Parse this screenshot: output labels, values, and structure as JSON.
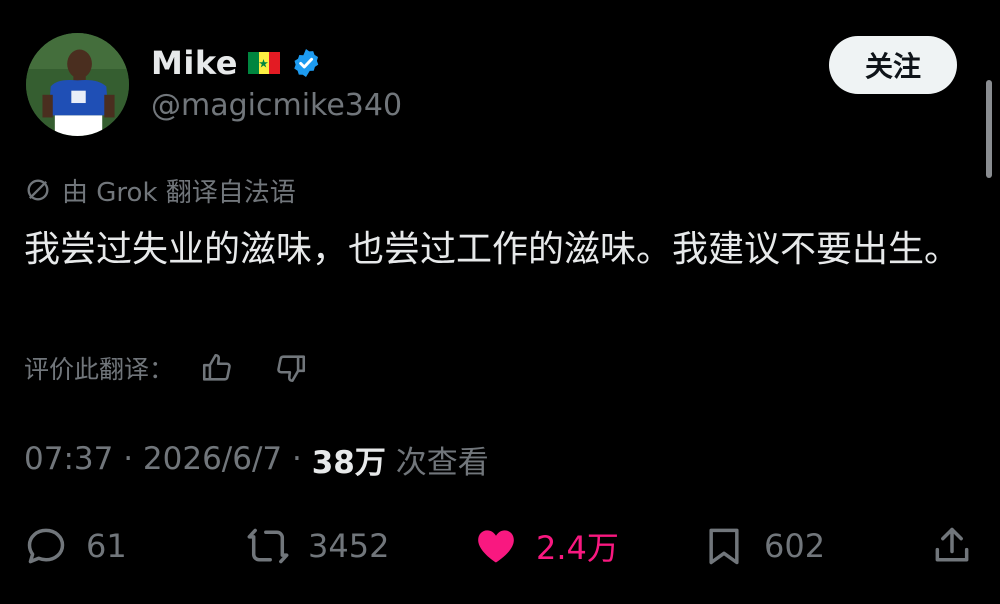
{
  "user": {
    "name": "Mike",
    "handle": "@magicmike340",
    "flag_colors": [
      "#00853f",
      "#fdef42",
      "#e31b23"
    ],
    "verified_color": "#1d9bf0",
    "follow_label": "关注"
  },
  "translation": {
    "note": "由 Grok 翻译自法语",
    "rate_label": "评价此翻译："
  },
  "tweet": {
    "text": "我尝过失业的滋味，也尝过工作的滋味。我建议不要出生。"
  },
  "meta": {
    "time": "07:37",
    "separator": " · ",
    "date": "2026/6/7",
    "views": "38万",
    "views_suffix": " 次查看"
  },
  "actions": {
    "replies": "61",
    "retweets": "3452",
    "likes": "2.4万",
    "bookmarks": "602",
    "like_color": "#f91880"
  },
  "icons": {
    "translate": "translate-icon",
    "thumbs_up": "thumbs-up-icon",
    "thumbs_down": "thumbs-down-icon",
    "reply": "reply-icon",
    "retweet": "retweet-icon",
    "like": "heart-icon",
    "bookmark": "bookmark-icon",
    "share": "share-icon"
  }
}
